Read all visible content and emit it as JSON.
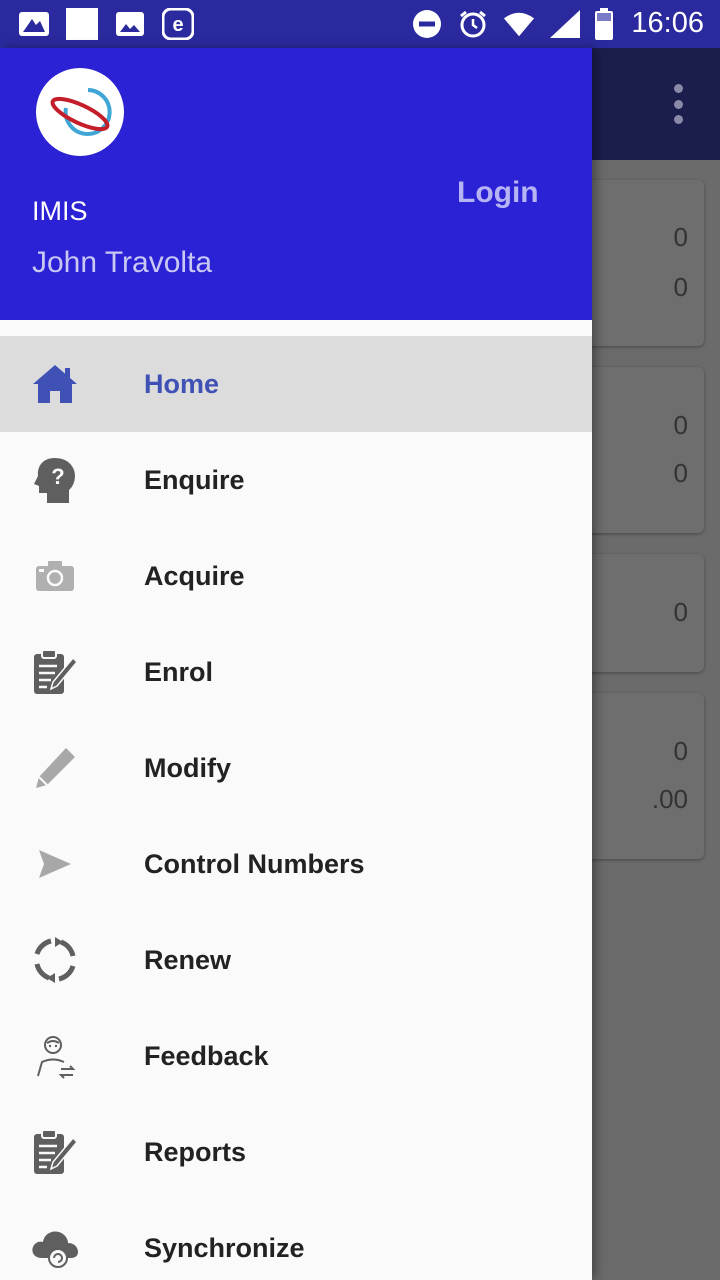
{
  "status_bar": {
    "time": "16:06",
    "left_icons": [
      "gallery-icon",
      "blank-notification-icon",
      "image-icon",
      "browser-e-icon"
    ],
    "right_icons": [
      "do-not-disturb-icon",
      "alarm-icon",
      "wifi-icon",
      "signal-icon",
      "battery-icon"
    ]
  },
  "drawer": {
    "header": {
      "app_name": "IMIS",
      "user_name": "John Travolta",
      "login_label": "Login",
      "background_color": "#2a22d4"
    },
    "menu": [
      {
        "label": "Home",
        "icon": "home-icon",
        "active": true
      },
      {
        "label": "Enquire",
        "icon": "enquire-head-icon",
        "active": false
      },
      {
        "label": "Acquire",
        "icon": "camera-icon",
        "active": false
      },
      {
        "label": "Enrol",
        "icon": "clipboard-edit-icon",
        "active": false
      },
      {
        "label": "Modify",
        "icon": "pencil-icon",
        "active": false
      },
      {
        "label": "Control Numbers",
        "icon": "send-icon",
        "active": false
      },
      {
        "label": "Renew",
        "icon": "renew-icon",
        "active": false
      },
      {
        "label": "Feedback",
        "icon": "feedback-person-icon",
        "active": false
      },
      {
        "label": "Reports",
        "icon": "reports-clipboard-icon",
        "active": false
      },
      {
        "label": "Synchronize",
        "icon": "cloud-sync-icon",
        "active": false
      }
    ]
  },
  "background": {
    "cards": [
      {
        "values": [
          "0",
          "0"
        ]
      },
      {
        "values": [
          "0",
          "0"
        ]
      },
      {
        "values": [
          "0"
        ]
      },
      {
        "values": [
          "0",
          ".00"
        ]
      }
    ]
  },
  "colors": {
    "accent": "#3f51b5",
    "status_bar": "#2a2a9e",
    "toolbar": "#1b1d4d"
  }
}
